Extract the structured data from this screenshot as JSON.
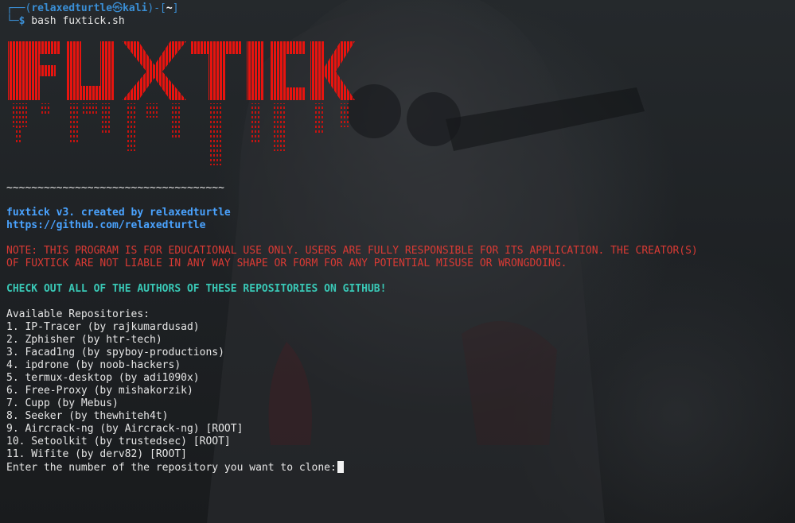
{
  "prompt": {
    "open": "┌──(",
    "user": "relaxedturtle",
    "at": "㉿",
    "host": "kali",
    "mid": ")-[",
    "dir": "~",
    "close": "]",
    "cmd_prefix": "└─",
    "dollar": "$",
    "command": " bash fuxtick.sh"
  },
  "banner": {
    "text": "FUXTICK",
    "color": "#e8140f"
  },
  "divider": "~~~~~~~~~~~~~~~~~~~~~~~~~~~~~~~~~~~",
  "credit": "fuxtick v3. created by relaxedturtle",
  "github_link": "https://github.com/relaxedturtle",
  "note": {
    "line1": "NOTE: THIS PROGRAM IS FOR EDUCATIONAL USE ONLY. USERS ARE FULLY RESPONSIBLE FOR ITS APPLICATION. THE CREATOR(S)",
    "line2": "OF FUXTICK ARE NOT LIABLE IN ANY WAY SHAPE OR FORM FOR ANY POTENTIAL MISUSE OR WRONGDOING."
  },
  "checkout": "CHECK OUT ALL OF THE AUTHORS OF THESE REPOSITORIES ON GITHUB!",
  "repos_title": "Available Repositories:",
  "repos": [
    "1. IP-Tracer (by rajkumardusad)",
    "2. Zphisher (by htr-tech)",
    "3. Facad1ng (by spyboy-productions)",
    "4. ipdrone (by noob-hackers)",
    "5. termux-desktop (by adi1090x)",
    "6. Free-Proxy (by mishakorzik)",
    "7. Cupp (by Mebus)",
    "8. Seeker (by thewhiteh4t)",
    "9. Aircrack-ng (by Aircrack-ng) [ROOT]",
    "10. Setoolkit (by trustedsec) [ROOT]",
    "11. Wifite (by derv82) [ROOT]"
  ],
  "input_prompt": "Enter the number of the repository you want to clone:"
}
